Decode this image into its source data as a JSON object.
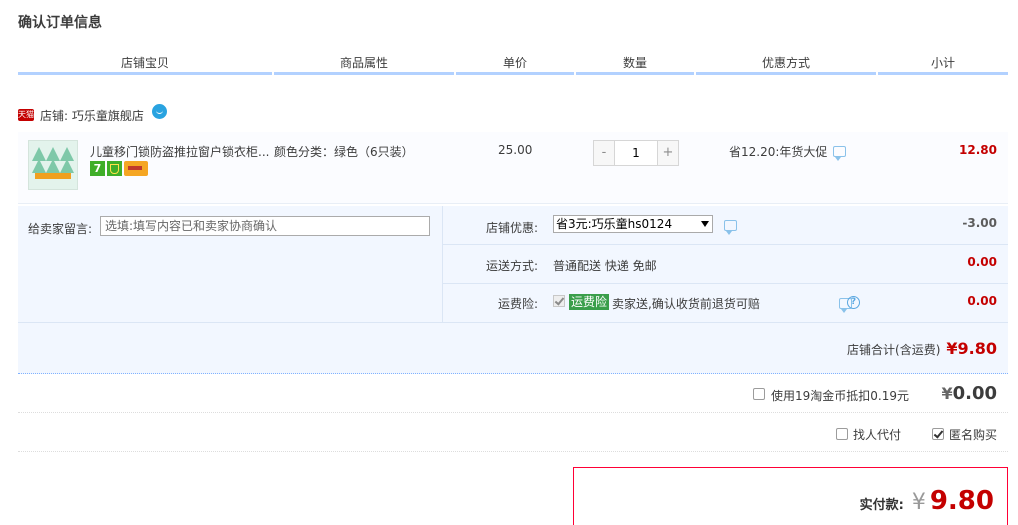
{
  "page_title": "确认订单信息",
  "columns": [
    "店铺宝贝",
    "商品属性",
    "单价",
    "数量",
    "优惠方式",
    "小计"
  ],
  "shop": {
    "badge": "天猫",
    "label": "店铺: 巧乐童旗舰店"
  },
  "item": {
    "title": "儿童移门锁防盗推拉窗户锁衣柜...",
    "attribute": "颜色分类：绿色（6只装）",
    "price": "25.00",
    "quantity": "1",
    "qty_minus": "-",
    "qty_plus": "+",
    "discount": "省12.20:年货大促",
    "subtotal": "12.80",
    "icon_seven": "7"
  },
  "memo": {
    "label": "给卖家留言:",
    "placeholder": "选填:填写内容已和卖家协商确认"
  },
  "coupon": {
    "label": "店铺优惠:",
    "selected": "省3元:巧乐童hs0124",
    "amount": "-3.00"
  },
  "shipping": {
    "label": "运送方式:",
    "value": "普通配送 快递 免邮",
    "amount": "0.00"
  },
  "insurance": {
    "label": "运费险:",
    "tag": "运费险",
    "text": "卖家送,确认收货前退货可赔",
    "amount": "0.00",
    "help": "?"
  },
  "shop_total": {
    "label": "店铺合计(含运费)",
    "amount": "¥9.80"
  },
  "coins": {
    "label": "使用19淘金币抵扣0.19元",
    "yen": "¥",
    "amount": "0.00"
  },
  "options": {
    "proxy_pay": "找人代付",
    "anonymous": "匿名购买"
  },
  "pay": {
    "label": "实付款:",
    "yen": "¥",
    "amount": "9.80"
  }
}
